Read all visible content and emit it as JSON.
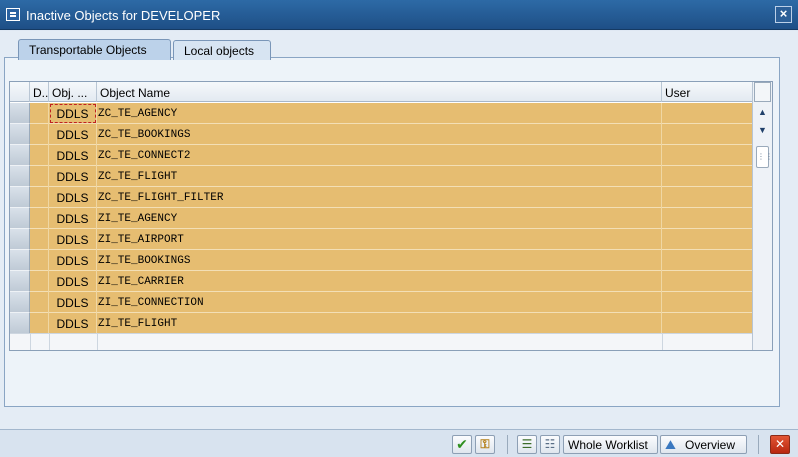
{
  "window": {
    "title": "Inactive Objects for DEVELOPER",
    "close_symbol": "×"
  },
  "tabs": [
    {
      "label": "Transportable Objects",
      "active": true
    },
    {
      "label": "Local objects",
      "active": false
    }
  ],
  "table": {
    "columns": [
      "D..",
      "Obj. ...",
      "Object Name",
      "User"
    ],
    "rows": [
      {
        "obj_type": "DDLS",
        "object_name": "ZC_TE_AGENCY",
        "user": ""
      },
      {
        "obj_type": "DDLS",
        "object_name": "ZC_TE_BOOKINGS",
        "user": ""
      },
      {
        "obj_type": "DDLS",
        "object_name": "ZC_TE_CONNECT2",
        "user": ""
      },
      {
        "obj_type": "DDLS",
        "object_name": "ZC_TE_FLIGHT",
        "user": ""
      },
      {
        "obj_type": "DDLS",
        "object_name": "ZC_TE_FLIGHT_FILTER",
        "user": ""
      },
      {
        "obj_type": "DDLS",
        "object_name": "ZI_TE_AGENCY",
        "user": ""
      },
      {
        "obj_type": "DDLS",
        "object_name": "ZI_TE_AIRPORT",
        "user": ""
      },
      {
        "obj_type": "DDLS",
        "object_name": "ZI_TE_BOOKINGS",
        "user": ""
      },
      {
        "obj_type": "DDLS",
        "object_name": "ZI_TE_CARRIER",
        "user": ""
      },
      {
        "obj_type": "DDLS",
        "object_name": "ZI_TE_CONNECTION",
        "user": ""
      },
      {
        "obj_type": "DDLS",
        "object_name": "ZI_TE_FLIGHT",
        "user": ""
      }
    ],
    "row_color": "#e6bd71"
  },
  "toolbar": {
    "whole_worklist_label": "Whole Worklist",
    "overview_label": "Overview",
    "icons": [
      "check-icon",
      "activate-anyway-icon",
      "select-all-icon",
      "deselect-all-icon",
      "overview-icon",
      "cancel-icon"
    ]
  },
  "colors": {
    "titlebar": "#2d6aa6",
    "cancel": "#c8391c"
  }
}
